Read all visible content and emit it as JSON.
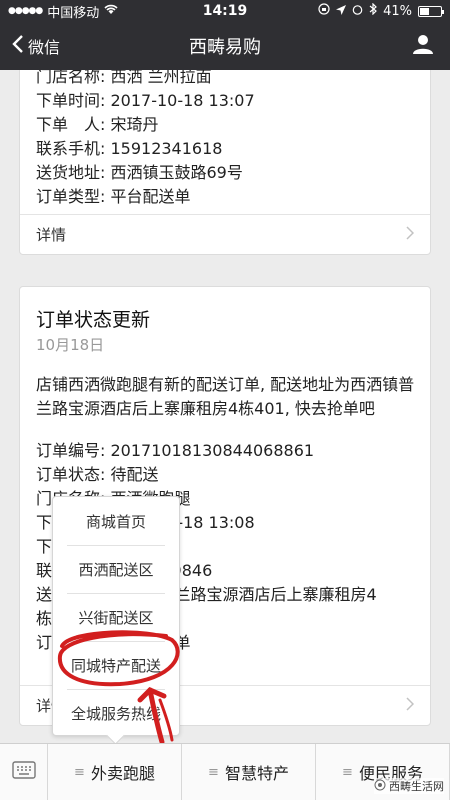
{
  "status_bar": {
    "carrier": "中国移动",
    "time": "14:19",
    "battery": "41%"
  },
  "nav": {
    "back_label": "微信",
    "title": "西畴易购",
    "user_icon": "user-icon"
  },
  "card1": {
    "fields": [
      "门店名称: 西洒 兰州拉面",
      "下单时间: 2017-10-18 13:07",
      "下单　人: 宋琦丹",
      "联系手机: 15912341618",
      "送货地址: 西洒镇玉鼓路69号",
      "订单类型: 平台配送单"
    ],
    "detail_label": "详情"
  },
  "card2": {
    "title": "订单状态更新",
    "date": "10月18日",
    "message": "店铺西洒微跑腿有新的配送订单, 配送地址为西洒镇普兰路宝源酒店后上寨廉租房4栋401, 快去抢单吧",
    "fields": [
      "订单编号: 20171018130844068861",
      "订单状态: 待配送",
      "门店名称: 西洒微跑腿",
      "下单时间: 2017-10-18 13:08",
      "下单　人: ",
      "联系手机: 1591239846",
      "送货地址: 西洒镇普兰路宝源酒店后上寨廉租房4",
      "栋401",
      "订单类型: 平台配送单"
    ],
    "detail_label": "详情"
  },
  "popup_menu": {
    "items": [
      "商城首页",
      "西洒配送区",
      "兴街配送区",
      "同城特产配送",
      "全城服务热线"
    ]
  },
  "bottom_bar": {
    "tabs": [
      "外卖跑腿",
      "智慧特产",
      "便民服务"
    ]
  },
  "watermark": "西畴生活网",
  "colors": {
    "header_bg": "#2f2f33",
    "annotation_red": "#d21f1f"
  }
}
